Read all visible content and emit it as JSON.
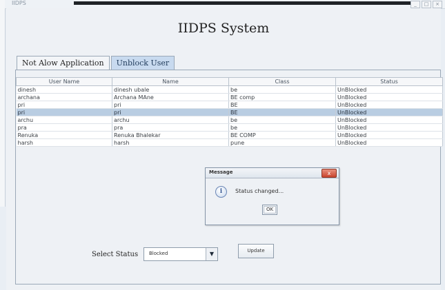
{
  "window": {
    "title": "IIDPS",
    "controls": [
      "_",
      "□",
      "×"
    ]
  },
  "app": {
    "title": "IIDPS System"
  },
  "tabs": [
    {
      "label": "Not Alow Application",
      "active": false
    },
    {
      "label": "Unblock User",
      "active": true
    }
  ],
  "table": {
    "columns": [
      "User Name",
      "Name",
      "Class",
      "Status"
    ],
    "rows": [
      {
        "user": "dinesh",
        "name": "dinesh ubale",
        "class": "be",
        "status": "UnBlocked",
        "selected": false
      },
      {
        "user": "archana",
        "name": "Archana MAne",
        "class": "BE comp",
        "status": "UnBlocked",
        "selected": false
      },
      {
        "user": "pri",
        "name": "pri",
        "class": "BE",
        "status": "UnBlocked",
        "selected": false
      },
      {
        "user": "pri",
        "name": "pri",
        "class": "BE",
        "status": "UnBlocked",
        "selected": true
      },
      {
        "user": "archu",
        "name": "archu",
        "class": "be",
        "status": "UnBlocked",
        "selected": false
      },
      {
        "user": "pra",
        "name": "pra",
        "class": "be",
        "status": "UnBlocked",
        "selected": false
      },
      {
        "user": "Renuka",
        "name": "Renuka Bhalekar",
        "class": "BE COMP",
        "status": "UnBlocked",
        "selected": false
      },
      {
        "user": "harsh",
        "name": "harsh",
        "class": "pune",
        "status": "UnBlocked",
        "selected": false
      }
    ]
  },
  "dialog": {
    "title": "Message",
    "message": "Status changed...",
    "ok_label": "OK",
    "close_label": "x"
  },
  "controls": {
    "select_label": "Select Status",
    "select_value": "Blocked",
    "select_arrow": "▼",
    "update_label": "Update"
  },
  "colors": {
    "selected_row": "#b9cde2",
    "active_tab": "#c8daef",
    "close_button": "#c9452e"
  }
}
